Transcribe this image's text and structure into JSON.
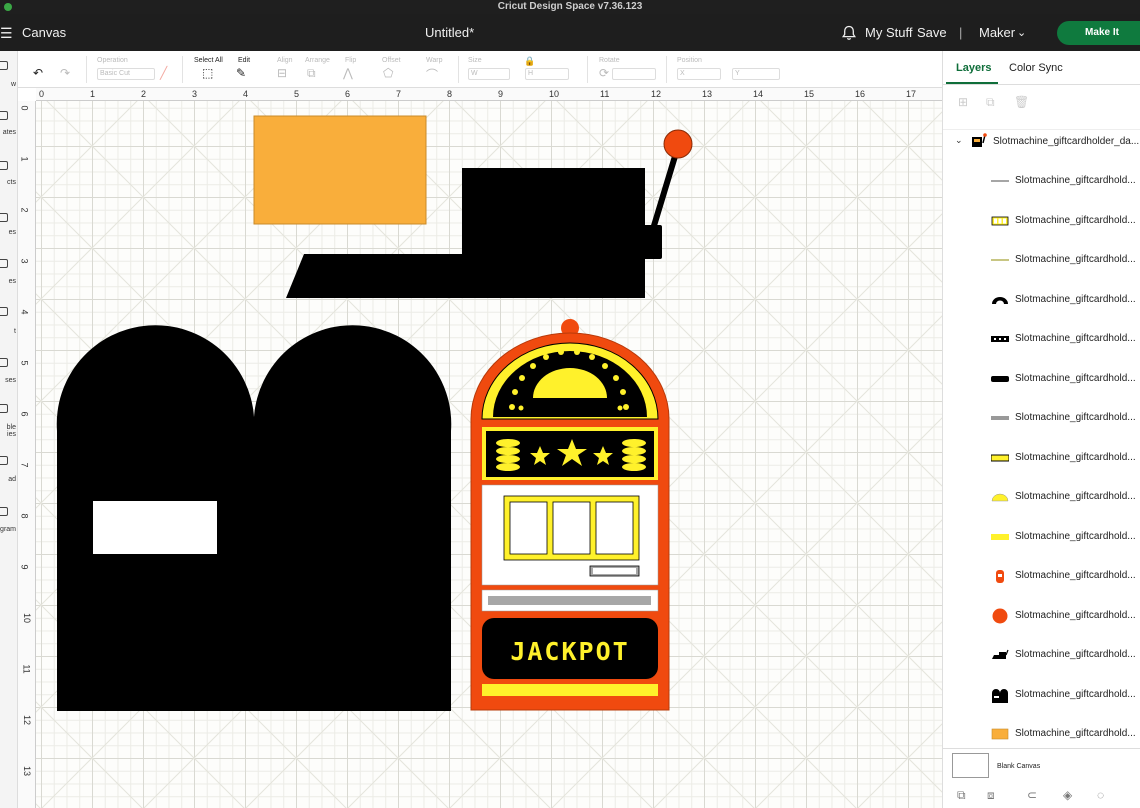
{
  "window": {
    "title": "Cricut Design Space  v7.36.123"
  },
  "header": {
    "menu_icon": "☰",
    "canvas_label": "Canvas",
    "doc_title": "Untitled*",
    "bell_icon": "bell-icon",
    "my_stuff": "My Stuff",
    "save": "Save",
    "separator": "|",
    "machine": "Maker",
    "make_it": "Make It"
  },
  "leftrail": {
    "items": [
      "w",
      "ates",
      "cts",
      "es",
      "es",
      "t",
      "ses",
      "ble\nies",
      "ad",
      "gram"
    ]
  },
  "toolbar": {
    "operation_label": "Operation",
    "operation_value": "Basic Cut",
    "select_all": "Select All",
    "edit": "Edit",
    "align": "Align",
    "arrange": "Arrange",
    "flip": "Flip",
    "offset": "Offset",
    "warp": "Warp",
    "size": "Size",
    "size_w": "W",
    "size_h": "H",
    "rotate": "Rotate",
    "position": "Position",
    "pos_x": "X",
    "pos_y": "Y"
  },
  "rulers": {
    "top": [
      "0",
      "1",
      "2",
      "3",
      "4",
      "5",
      "6",
      "7",
      "8",
      "9",
      "10",
      "11",
      "12",
      "13",
      "14",
      "15",
      "16",
      "17"
    ],
    "left": [
      "0",
      "1",
      "2",
      "3",
      "4",
      "5",
      "6",
      "7",
      "8",
      "9",
      "10",
      "11",
      "12",
      "13"
    ]
  },
  "canvas": {
    "jackpot_text": "JACKPOT",
    "colors": {
      "orange_rect": "#f9ae3b",
      "black": "#000000",
      "red": "#f04a0f",
      "yellow": "#fff12b",
      "gray": "#a7a7a7",
      "white": "#ffffff"
    }
  },
  "panel": {
    "tabs": [
      "Layers",
      "Color Sync"
    ],
    "group_name": "Slotmachine_giftcardholder_da...",
    "layers": [
      {
        "name": "Slotmachine_giftcardhold...",
        "icon": "gray-line-icon"
      },
      {
        "name": "Slotmachine_giftcardhold...",
        "icon": "reel-window-icon"
      },
      {
        "name": "Slotmachine_giftcardhold...",
        "icon": "olive-line-icon"
      },
      {
        "name": "Slotmachine_giftcardhold...",
        "icon": "black-dome-icon"
      },
      {
        "name": "Slotmachine_giftcardhold...",
        "icon": "black-bar-dots-icon"
      },
      {
        "name": "Slotmachine_giftcardhold...",
        "icon": "black-bar-icon"
      },
      {
        "name": "Slotmachine_giftcardhold...",
        "icon": "gray-bar-icon"
      },
      {
        "name": "Slotmachine_giftcardhold...",
        "icon": "yellow-black-bar-icon"
      },
      {
        "name": "Slotmachine_giftcardhold...",
        "icon": "yellow-dome-icon"
      },
      {
        "name": "Slotmachine_giftcardhold...",
        "icon": "yellow-bar-icon"
      },
      {
        "name": "Slotmachine_giftcardhold...",
        "icon": "red-machine-icon"
      },
      {
        "name": "Slotmachine_giftcardhold...",
        "icon": "red-circle-icon"
      },
      {
        "name": "Slotmachine_giftcardhold...",
        "icon": "black-lever-icon"
      },
      {
        "name": "Slotmachine_giftcardhold...",
        "icon": "black-holder-icon"
      },
      {
        "name": "Slotmachine_giftcardhold...",
        "icon": "orange-rect-icon"
      }
    ],
    "blank_canvas": "Blank Canvas"
  }
}
